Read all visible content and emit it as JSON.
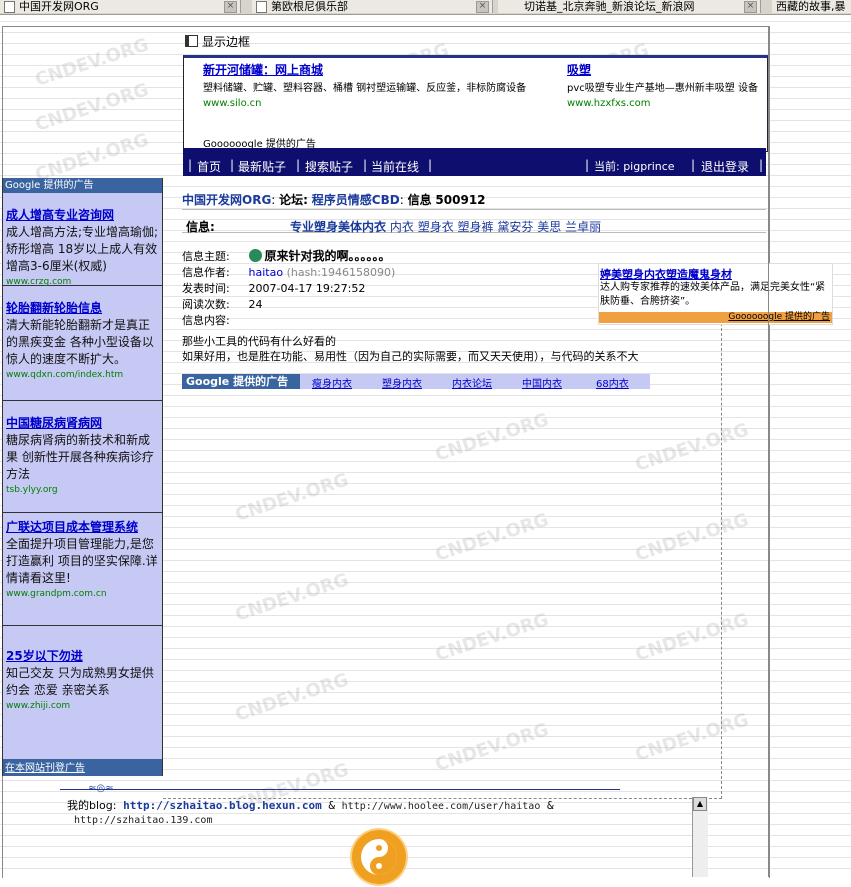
{
  "tabs": [
    {
      "label": "中国开发网ORG"
    },
    {
      "label": "第欧根尼俱乐部"
    },
    {
      "label": "切诺基_北京奔驰_新浪论坛_新浪网"
    },
    {
      "label": "西藏的故事,暴"
    }
  ],
  "show_border_label": "显示边框",
  "top_ad": {
    "left": {
      "title": "新开河储罐：网上商城",
      "desc": "塑料储罐、贮罐、塑料容器、桶槽 钢衬塑运输罐、反应釜，非标防腐设备",
      "url": "www.silo.cn"
    },
    "right": {
      "title": "吸塑",
      "desc": "pvc吸塑专业生产基地—惠州新丰吸塑 设备",
      "url": "www.hzxfxs.com"
    },
    "provider": "Goooooogle 提供的广告"
  },
  "nav": {
    "home": "首页",
    "latest": "最新贴子",
    "search": "搜索贴子",
    "online": "当前在线",
    "current_user_label": "当前: pigprince",
    "logout": "退出登录"
  },
  "breadcrumb": {
    "site": "中国开发网ORG",
    "forum_label": "论坛:",
    "forum": "程序员情感CBD",
    "msg_label": "信息",
    "msg_id": "500912"
  },
  "info_bar": {
    "label": "信息:",
    "keywords": [
      "专业塑身美体内衣",
      "内衣",
      "塑身衣",
      "塑身裤",
      "黛安芬",
      "美思",
      "兰卓丽"
    ]
  },
  "post": {
    "subject_label": "信息主题:",
    "subject": "原来针对我的啊。。。。。。",
    "author_label": "信息作者:",
    "author": "haitao",
    "hash": "(hash:1946158090)",
    "time_label": "发表时间:",
    "time": "2007-04-17 19:27:52",
    "views_label": "阅读次数:",
    "views": "24",
    "content_label": "信息内容:",
    "line1": "那些小工具的代码有什么好看的",
    "line2": "如果好用，也是胜在功能、易用性（因为自己的实际需要，而又天天使用），与代码的关系不大"
  },
  "right_ad": {
    "title": "婷美塑身内衣塑造魔鬼身材",
    "desc": "达人购专家推荐的速效美体产品，满足完美女性“紧肤防垂、合胯挤姿”。",
    "provider": "Goooooogle 提供的广告"
  },
  "google_bar": {
    "heading": "Google 提供的广告",
    "links": [
      "瘦身内衣",
      "塑身内衣",
      "内衣论坛",
      "中国内衣",
      "68内衣"
    ]
  },
  "left_ads": {
    "header": "Google 提供的广告",
    "items": [
      {
        "title": "成人增高专业咨询网",
        "desc": "成人增高方法;专业增高瑜伽;矫形增高 18岁以上成人有效增高3-6厘米(权威)",
        "url": "www.crzg.com"
      },
      {
        "title": "轮胎翻新轮胎信息",
        "desc": "清大新能轮胎翻新才是真正的黑疾变金 各种小型设备以惊人的速度不断扩大。",
        "url": "www.qdxn.com/index.htm"
      },
      {
        "title": "中国糖尿病肾病网",
        "desc": "糖尿病肾病的新技术和新成果 创新性开展各种疾病诊疗方法",
        "url": "tsb.ylyy.org"
      },
      {
        "title": "广联达项目成本管理系统",
        "desc": "全面提升项目管理能力,是您打造赢利 项目的坚实保障.详情请看这里!",
        "url": "www.grandpm.com.cn"
      },
      {
        "title": "25岁以下勿进",
        "desc": "知己交友 只为成熟男女提供 约会 恋爱 亲密关系",
        "url": "www.zhiji.com"
      }
    ],
    "footer": "在本网站刊登广告"
  },
  "signature": {
    "prefix": "我的blog:",
    "blog1": "http://szhaitao.blog.hexun.com",
    "amp1": "&",
    "blog2": "http://www.hoolee.com/user/haitao",
    "amp2": "&",
    "blog3": "http://szhaitao.139.com"
  },
  "watermark": "CNDEV.ORG",
  "colors": {
    "nav_bg": "#0e0e6e",
    "ad_bg": "#c6c9f4",
    "ad_header": "#3a64a0",
    "link": "#0000cc",
    "right_ad_accent": "#f0a040"
  }
}
